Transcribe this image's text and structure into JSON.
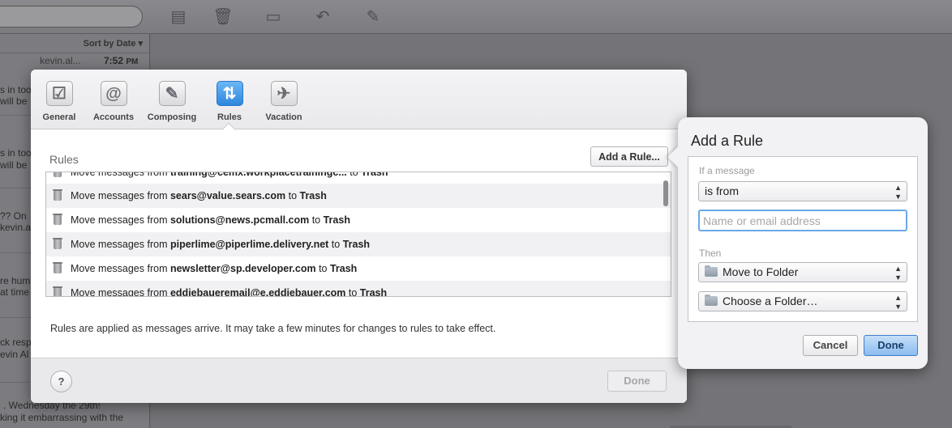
{
  "mail_toolbar": {
    "icons": [
      "move-to-folder-icon",
      "trash-icon",
      "archive-icon",
      "reply-icon",
      "compose-icon"
    ]
  },
  "message_list": {
    "sort_label": "Sort by Date",
    "first_sender": "kevin.al...",
    "first_time": "7:52",
    "first_time_suffix": "PM",
    "fragments": [
      "s in too",
      "will be",
      "s in too",
      "will be",
      "?? On",
      "kevin.a",
      "re hum",
      "at time",
      "ck resp",
      "evin Al",
      ". Wednesday the 29th!",
      "king it embarrassing with the"
    ]
  },
  "prefs": {
    "tabs": [
      {
        "label": "General",
        "icon": "checkbox-icon",
        "glyph": "☑"
      },
      {
        "label": "Accounts",
        "icon": "at-icon",
        "glyph": "@"
      },
      {
        "label": "Composing",
        "icon": "compose-icon",
        "glyph": "✎"
      },
      {
        "label": "Rules",
        "icon": "rules-icon",
        "glyph": "⇅"
      },
      {
        "label": "Vacation",
        "icon": "airplane-icon",
        "glyph": "✈"
      }
    ],
    "active_tab": "Rules",
    "rules_heading": "Rules",
    "add_rule_label": "Add a Rule...",
    "rules": [
      {
        "prefix": "Move messages from ",
        "address": "training@cemx.workplacetrainingc...",
        "mid": " to ",
        "target": "Trash"
      },
      {
        "prefix": "Move messages from ",
        "address": "sears@value.sears.com",
        "mid": " to ",
        "target": "Trash"
      },
      {
        "prefix": "Move messages from ",
        "address": "solutions@news.pcmall.com",
        "mid": " to ",
        "target": "Trash"
      },
      {
        "prefix": "Move messages from ",
        "address": "piperlime@piperlime.delivery.net",
        "mid": " to ",
        "target": "Trash"
      },
      {
        "prefix": "Move messages from ",
        "address": "newsletter@sp.developer.com",
        "mid": " to ",
        "target": "Trash"
      },
      {
        "prefix": "Move messages from ",
        "address": "eddiebaueremail@e.eddiebauer.com",
        "mid": " to ",
        "target": "Trash"
      }
    ],
    "footnote": "Rules are applied as messages arrive. It may take a few minutes for changes to rules to take effect.",
    "help_label": "?",
    "done_label": "Done"
  },
  "add_rule": {
    "title": "Add a Rule",
    "condition_label": "If a message",
    "condition_value": "is from",
    "address_value": "",
    "address_placeholder": "Name or email address",
    "action_label": "Then",
    "action_value": "Move to Folder",
    "folder_value": "Choose a Folder…",
    "cancel_label": "Cancel",
    "done_label": "Done"
  }
}
